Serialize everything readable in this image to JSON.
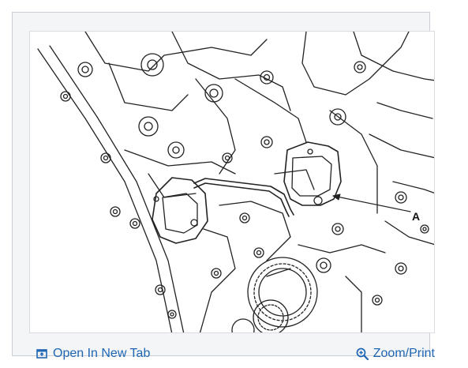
{
  "figure": {
    "callout_label": "A"
  },
  "footer": {
    "open_new_tab_label": "Open In New Tab",
    "open_new_tab_icon": "open-new-tab-icon",
    "zoom_print_label": "Zoom/Print",
    "zoom_print_icon": "zoom-icon"
  },
  "colors": {
    "link": "#1f66b3",
    "card_background": "#f3f5f7",
    "border": "#c9ced4"
  }
}
